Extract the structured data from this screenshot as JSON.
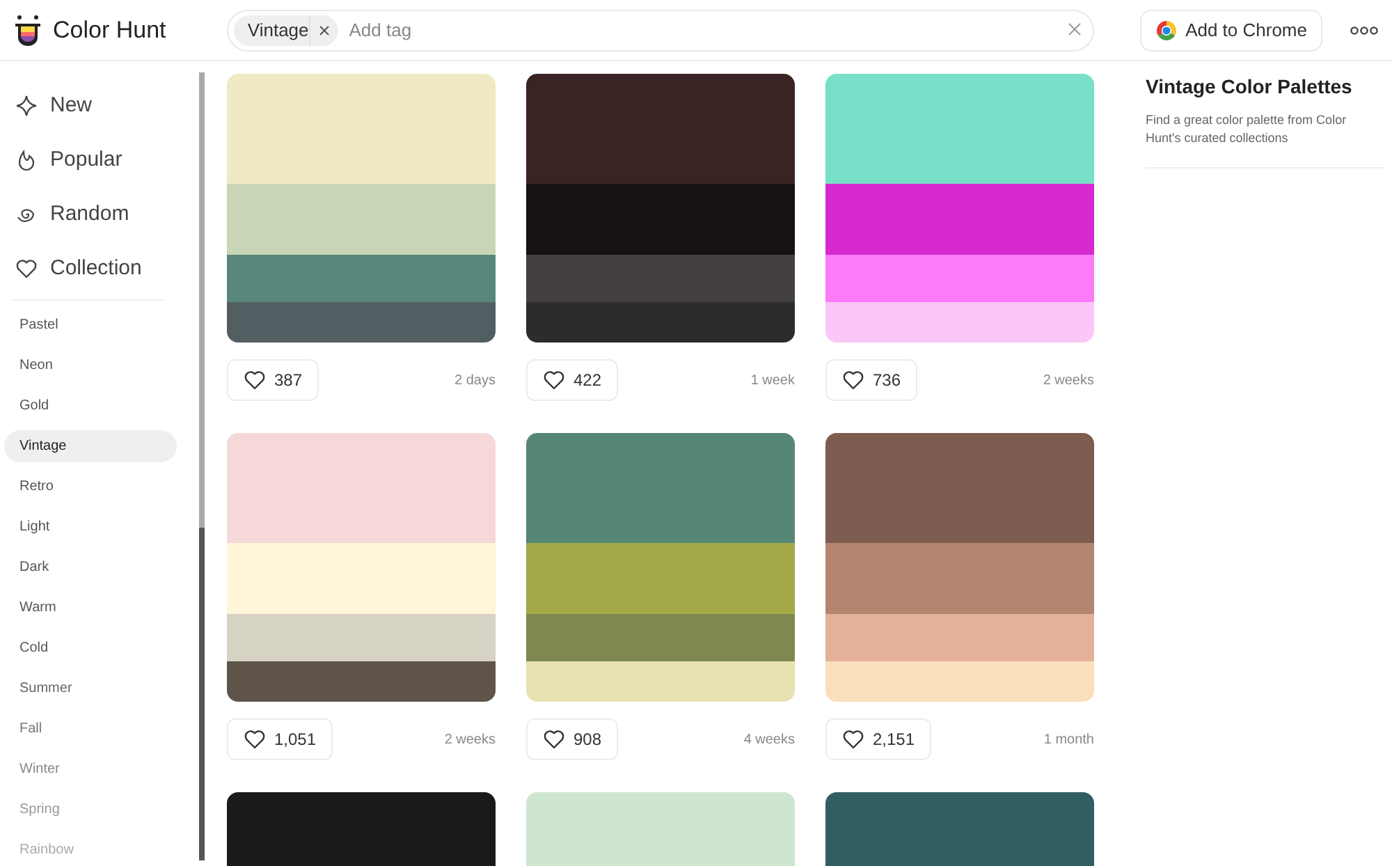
{
  "header": {
    "brand": "Color Hunt",
    "search": {
      "tags": [
        {
          "label": "Vintage"
        }
      ],
      "placeholder": "Add tag"
    },
    "chrome_button": "Add to Chrome"
  },
  "sidebar": {
    "nav": [
      {
        "label": "New",
        "kind": "new"
      },
      {
        "label": "Popular",
        "kind": "popular"
      },
      {
        "label": "Random",
        "kind": "random"
      },
      {
        "label": "Collection",
        "kind": "collection"
      }
    ],
    "categories": [
      {
        "label": "Pastel",
        "selected": false
      },
      {
        "label": "Neon",
        "selected": false
      },
      {
        "label": "Gold",
        "selected": false
      },
      {
        "label": "Vintage",
        "selected": true
      },
      {
        "label": "Retro",
        "selected": false
      },
      {
        "label": "Light",
        "selected": false
      },
      {
        "label": "Dark",
        "selected": false
      },
      {
        "label": "Warm",
        "selected": false
      },
      {
        "label": "Cold",
        "selected": false
      },
      {
        "label": "Summer",
        "selected": false
      },
      {
        "label": "Fall",
        "selected": false
      },
      {
        "label": "Winter",
        "selected": false
      },
      {
        "label": "Spring",
        "selected": false
      },
      {
        "label": "Rainbow",
        "selected": false
      }
    ]
  },
  "palettes": [
    {
      "swatches": [
        {
          "color": "#f0eac4"
        },
        {
          "color": "#c8d6b6"
        },
        {
          "color": "#57877a"
        },
        {
          "color": "#525e62"
        }
      ],
      "likes": "387",
      "age": "2 days"
    },
    {
      "swatches": [
        {
          "color": "#3a2323"
        },
        {
          "color": "#181111"
        },
        {
          "color": "#444040"
        },
        {
          "color": "#2c2c2c"
        }
      ],
      "likes": "422",
      "age": "1 week"
    },
    {
      "swatches": [
        {
          "color": "#78dfc8"
        },
        {
          "color": "#d62ad0"
        },
        {
          "color": "#fb7bf8"
        },
        {
          "color": "#fbc7f7"
        }
      ],
      "likes": "736",
      "age": "2 weeks"
    },
    {
      "swatches": [
        {
          "color": "#f7d8d9"
        },
        {
          "color": "#fff5d8"
        },
        {
          "color": "#d6d2c4"
        },
        {
          "color": "#5e544a"
        }
      ],
      "likes": "1,051",
      "age": "2 weeks"
    },
    {
      "swatches": [
        {
          "color": "#568776"
        },
        {
          "color": "#a3a948"
        },
        {
          "color": "#7e8952"
        },
        {
          "color": "#e8e1b1"
        }
      ],
      "likes": "908",
      "age": "4 weeks"
    },
    {
      "swatches": [
        {
          "color": "#7e5c4f"
        },
        {
          "color": "#b4856e"
        },
        {
          "color": "#e5b099"
        },
        {
          "color": "#fadfbd"
        }
      ],
      "likes": "2,151",
      "age": "1 month"
    },
    {
      "swatches": [
        {
          "color": "#1a1a1a"
        }
      ]
    },
    {
      "swatches": [
        {
          "color": "#cee5d0"
        }
      ]
    },
    {
      "swatches": [
        {
          "color": "#315e63"
        }
      ]
    }
  ],
  "info": {
    "title": "Vintage Color Palettes",
    "description": "Find a great color palette from Color Hunt's curated collections"
  }
}
